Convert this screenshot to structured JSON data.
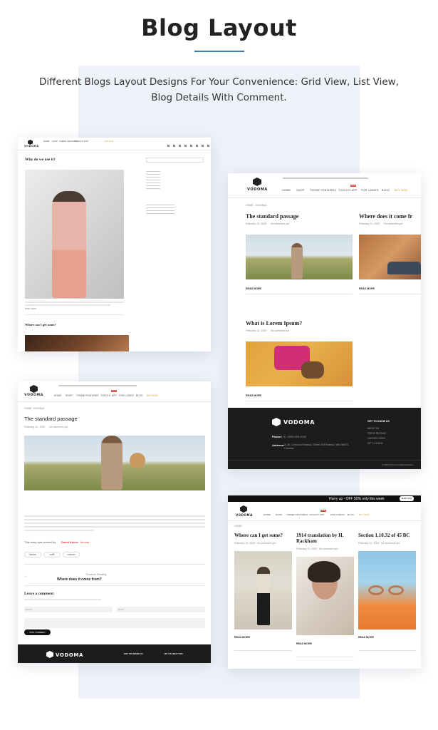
{
  "header": {
    "title": "Blog Layout",
    "subtitle": "Different Blogs Layout Designs For Your Convenience: Grid View, List View, Blog Details With Comment."
  },
  "brand": {
    "name": "VODOMA",
    "accent": "#d53a3a",
    "underline": "#3f7fa6",
    "footer_bg": "#1c1c1c"
  },
  "card_list": {
    "post_title": "Why do we use it?",
    "post2_title": "Where can I get some?",
    "read_more": "read more"
  },
  "card_grid": {
    "crumb_home": "HOME",
    "crumb_page": "JOURNAL",
    "nav": [
      "HOME",
      "SHOP",
      "THEME FEATURES",
      "TOOLKIT APP",
      "FOR LADIES",
      "BLOG",
      "BUY NOW"
    ],
    "badge": "New",
    "posts": [
      {
        "title": "The standard passage",
        "date": "February 12, 2020",
        "comments": "No comment yet",
        "read_more": "READ MORE"
      },
      {
        "title": "Where does it come fr",
        "date": "February 12, 2020",
        "comments": "No comment yet",
        "read_more": "READ MORE"
      },
      {
        "title": "What is Lorem Ipsum?",
        "date": "February 12, 2020",
        "comments": "No comment yet",
        "read_more": "READ MORE"
      }
    ],
    "footer": {
      "col_title": "GET TO KNOW US",
      "links": [
        "ABOUT US",
        "PRESS RELEASE",
        "CAREER CARES",
        "GIFT & SHELB"
      ],
      "phone_label": "Phone:",
      "phone": "(+1) 1800 555 2020",
      "address_label": "Address:",
      "address": "A-30, Liverpool Marina, Street 409 Marina, WA 98070, Canada",
      "copyright": "© 2020 Vodoma by BeautiHomes"
    }
  },
  "card_detail": {
    "title": "The standard passage",
    "date": "February 12, 2020",
    "comments": "No comment yet",
    "posted_by_prefix": "This entry was posted by",
    "author": "David Aken",
    "in_word": "in",
    "category": "Journal",
    "tags": [
      "fashion",
      "outfit",
      "summer"
    ],
    "prev_label": "Previous Reading",
    "prev_title": "Where does it come from?",
    "leave_comment": "Leave a comment",
    "footer_col1": "GET TO KNOW US",
    "footer_col2": "LET US HELP YOU",
    "post_comment": "POST COMMENT",
    "name_placeholder": "Name*",
    "email_placeholder": "Email*"
  },
  "card_columns": {
    "promo": "Hurry up - OFF 50% only this week",
    "shop_now": "SHOP NOW",
    "posts": [
      {
        "title": "Where can I get some?",
        "date": "February 12, 2020",
        "comments": "No comment yet",
        "read_more": "READ MORE"
      },
      {
        "title": "1914 translation by H. Rackham",
        "date": "February 12, 2020",
        "comments": "No comment yet",
        "read_more": "READ MORE"
      },
      {
        "title": "Section 1.10.32 of 45 BC",
        "date": "February 12, 2020",
        "comments": "No comment yet",
        "read_more": "READ MORE"
      }
    ]
  }
}
